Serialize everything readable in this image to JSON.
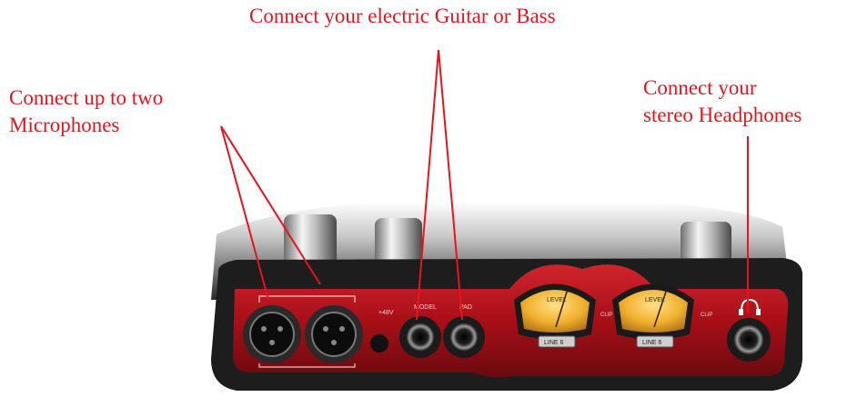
{
  "labels": {
    "microphones": [
      "Connect up to two",
      "Microphones"
    ],
    "guitar": "Connect your electric Guitar or Bass",
    "headphones": [
      "Connect your",
      "stereo Headphones"
    ]
  },
  "device": {
    "input_labels": [
      "+48V",
      "MODEL",
      "PAD"
    ],
    "meter_label": "LEVEL",
    "clip_label": "CLIP",
    "brand_logo": "LINE 6"
  },
  "colors": {
    "label_red": "#e8141c",
    "device_red": "#b01018",
    "meter_amber": "#e9a928"
  },
  "icons": [
    "xlr-jack-icon",
    "quarter-inch-jack-icon",
    "headphone-icon",
    "vu-meter-icon"
  ]
}
